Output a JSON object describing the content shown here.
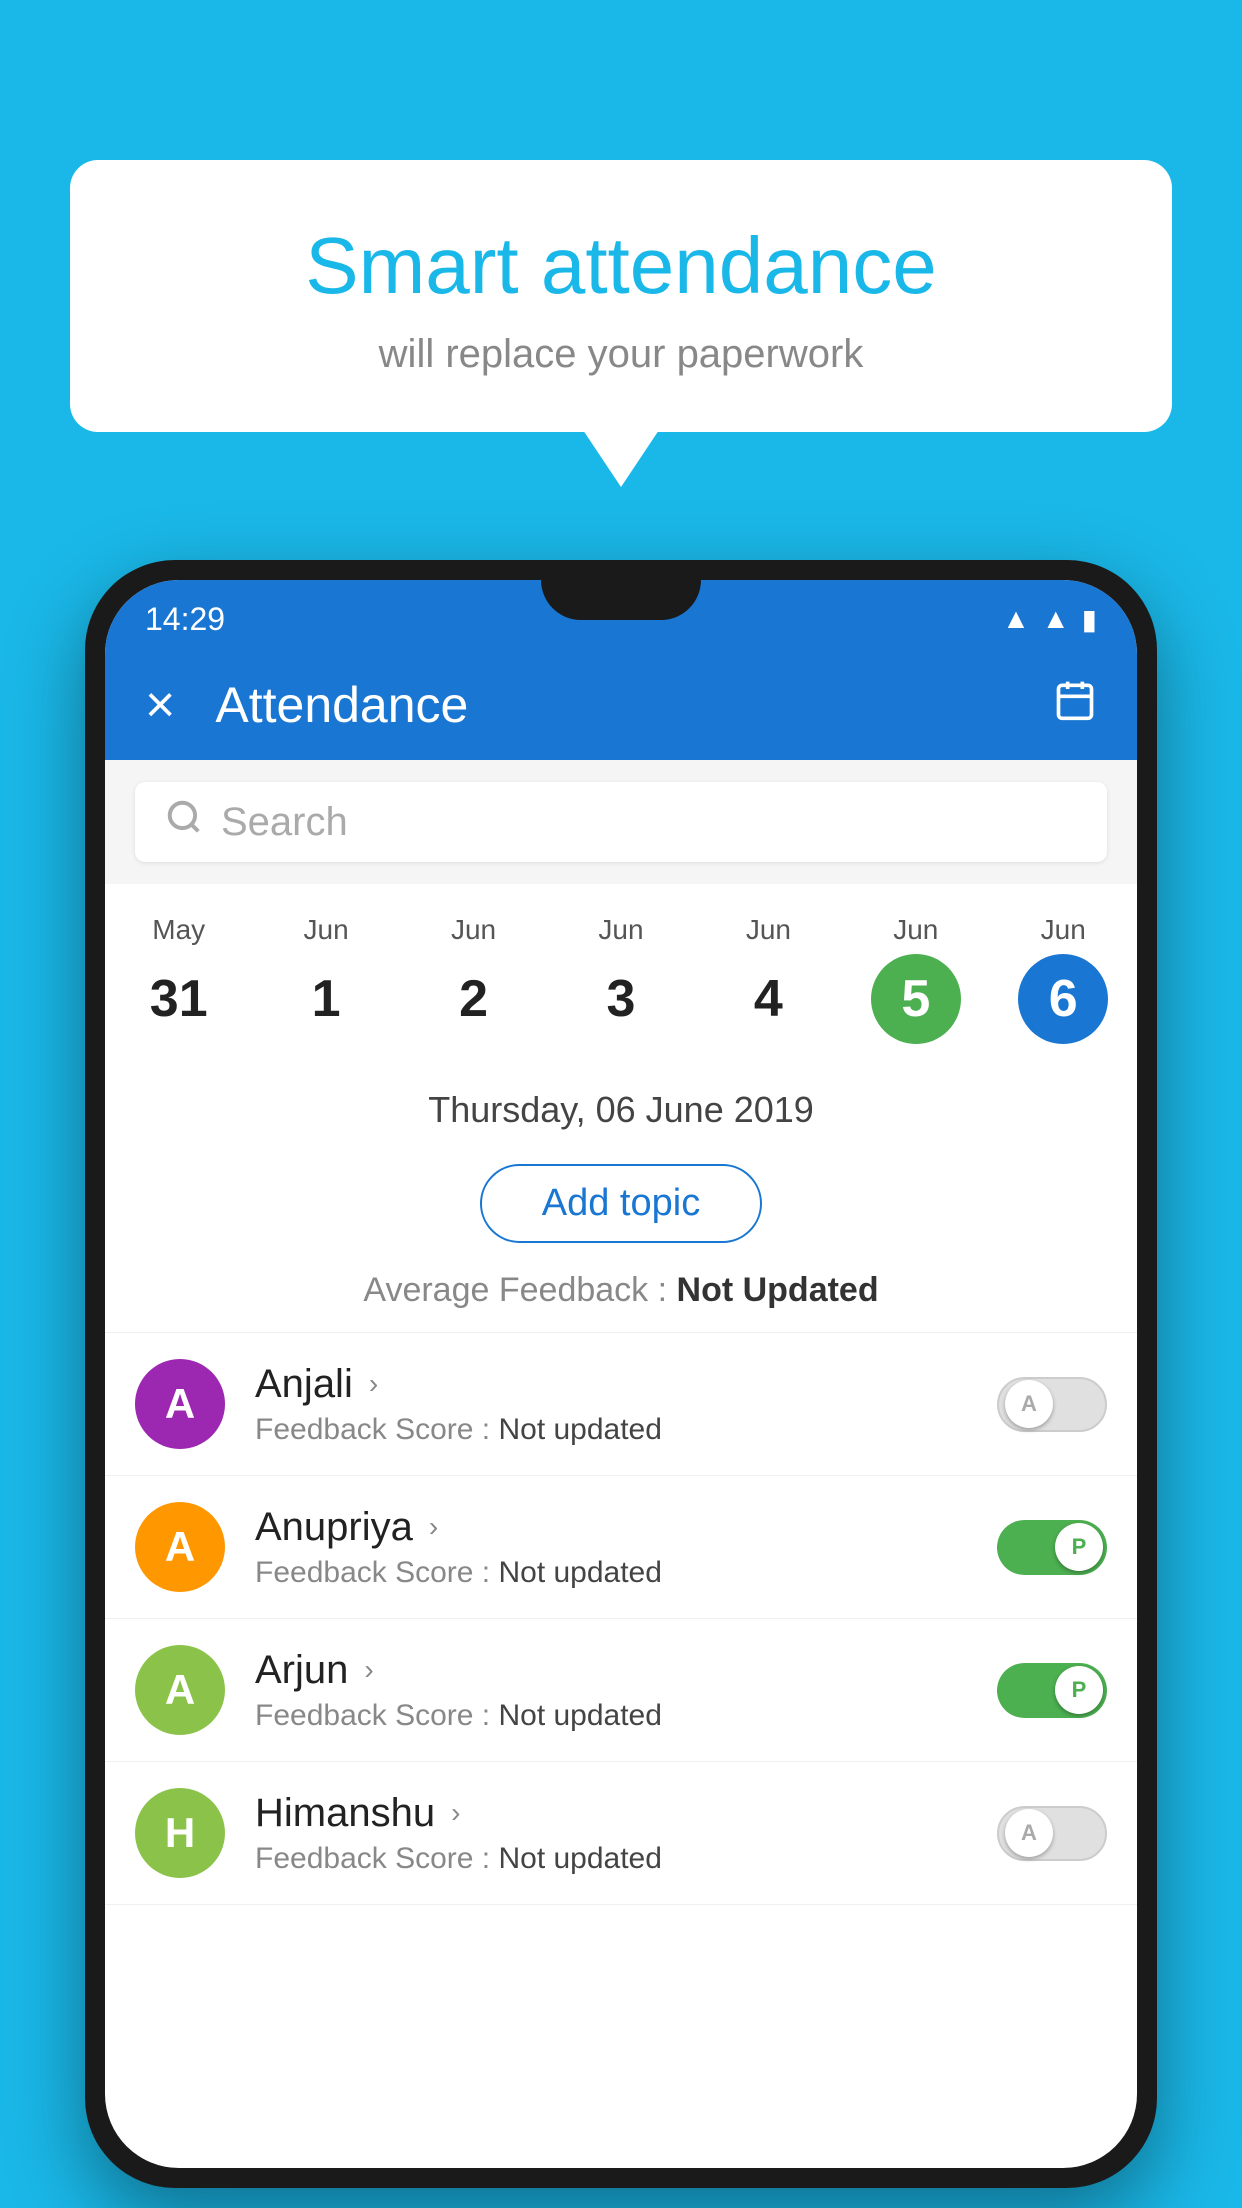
{
  "background_color": "#1ab8e8",
  "speech_bubble": {
    "title": "Smart attendance",
    "subtitle": "will replace your paperwork"
  },
  "status_bar": {
    "time": "14:29",
    "icons": [
      "wifi",
      "signal",
      "battery"
    ]
  },
  "toolbar": {
    "title": "Attendance",
    "close_label": "×",
    "calendar_label": "📅"
  },
  "search": {
    "placeholder": "Search"
  },
  "calendar": {
    "days": [
      {
        "month": "May",
        "date": "31",
        "state": "normal"
      },
      {
        "month": "Jun",
        "date": "1",
        "state": "normal"
      },
      {
        "month": "Jun",
        "date": "2",
        "state": "normal"
      },
      {
        "month": "Jun",
        "date": "3",
        "state": "normal"
      },
      {
        "month": "Jun",
        "date": "4",
        "state": "normal"
      },
      {
        "month": "Jun",
        "date": "5",
        "state": "today"
      },
      {
        "month": "Jun",
        "date": "6",
        "state": "selected"
      }
    ]
  },
  "date_header": "Thursday, 06 June 2019",
  "add_topic_label": "Add topic",
  "avg_feedback": {
    "label": "Average Feedback : ",
    "value": "Not Updated"
  },
  "students": [
    {
      "name": "Anjali",
      "avatar_letter": "A",
      "avatar_color": "#9c27b0",
      "feedback_label": "Feedback Score : ",
      "feedback_value": "Not updated",
      "toggle_state": "off",
      "toggle_letter": "A"
    },
    {
      "name": "Anupriya",
      "avatar_letter": "A",
      "avatar_color": "#ff9800",
      "feedback_label": "Feedback Score : ",
      "feedback_value": "Not updated",
      "toggle_state": "on",
      "toggle_letter": "P"
    },
    {
      "name": "Arjun",
      "avatar_letter": "A",
      "avatar_color": "#8bc34a",
      "feedback_label": "Feedback Score : ",
      "feedback_value": "Not updated",
      "toggle_state": "on",
      "toggle_letter": "P"
    },
    {
      "name": "Himanshu",
      "avatar_letter": "H",
      "avatar_color": "#8bc34a",
      "feedback_label": "Feedback Score : ",
      "feedback_value": "Not updated",
      "toggle_state": "off",
      "toggle_letter": "A"
    }
  ]
}
